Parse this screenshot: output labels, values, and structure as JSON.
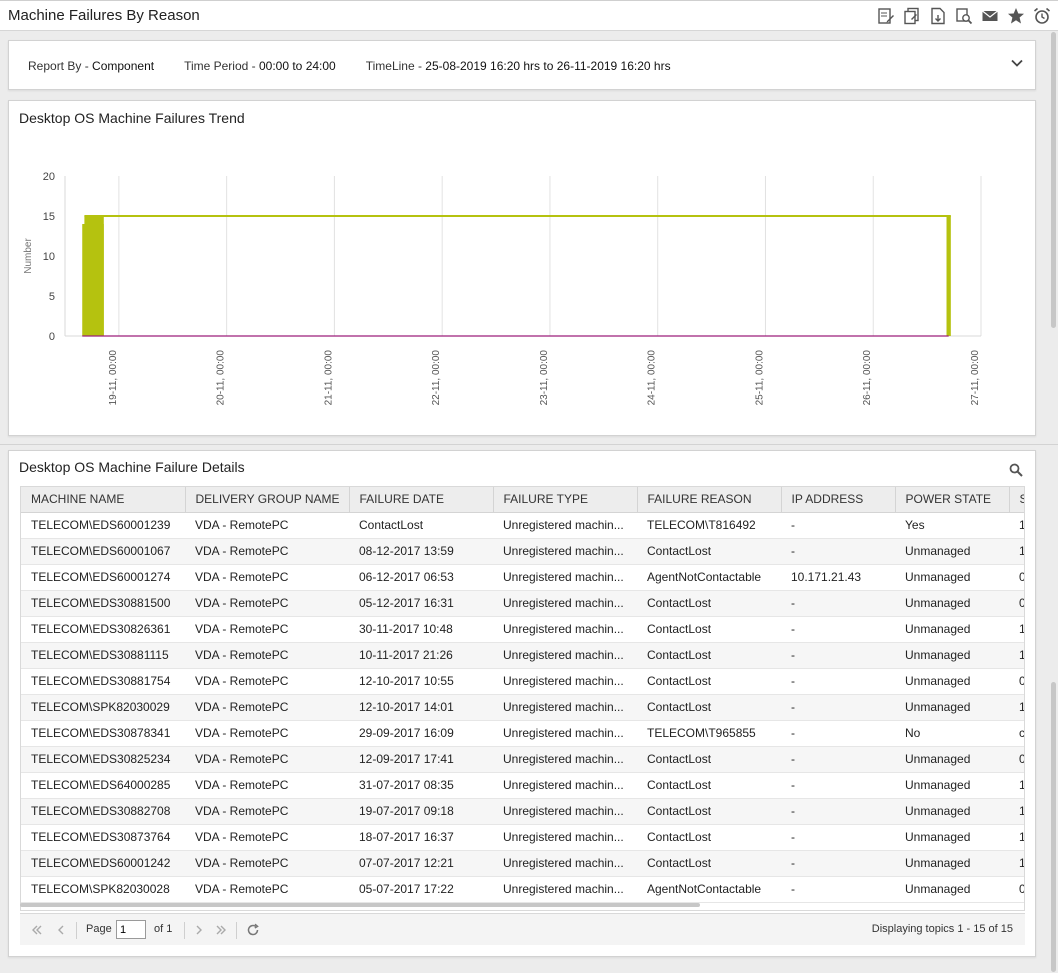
{
  "app": {
    "title": "Machine Failures By Reason"
  },
  "toolbar": {
    "icons": [
      "edit-report-icon",
      "copy-report-icon",
      "export-pdf-icon",
      "print-preview-icon",
      "email-icon",
      "favorite-star-icon",
      "alarm-clock-icon"
    ]
  },
  "filter": {
    "report_by_label": "Report By - ",
    "report_by_value": "Component",
    "time_period_label": "Time Period - ",
    "time_period_value": "00:00 to 24:00",
    "timeline_label": "TimeLine - ",
    "timeline_value": "25-08-2019 16:20 hrs to 26-11-2019 16:20 hrs"
  },
  "chart_panel": {
    "title": "Desktop OS Machine Failures Trend"
  },
  "chart_data": {
    "type": "area",
    "title": "Desktop OS Machine Failures Trend",
    "ylabel": "Number",
    "xlabel": "",
    "ylim": [
      0,
      20
    ],
    "yticks": [
      0,
      5,
      10,
      15,
      20
    ],
    "xlim": [
      18.5,
      27.0
    ],
    "xticks": [
      19,
      20,
      21,
      22,
      23,
      24,
      25,
      26,
      27
    ],
    "xtick_labels": [
      "19-11, 00:00",
      "20-11, 00:00",
      "21-11, 00:00",
      "22-11, 00:00",
      "23-11, 00:00",
      "24-11, 00:00",
      "25-11, 00:00",
      "26-11, 00:00",
      "27-11, 00:00"
    ],
    "grid": "vertical",
    "colors": {
      "series_main": "#b5c20f",
      "series_secondary": "#9c1f7b"
    },
    "series": [
      {
        "x": [
          18.66,
          18.68,
          18.7,
          18.72,
          18.86,
          26.68,
          26.72
        ],
        "y": [
          14,
          15,
          15,
          15,
          15,
          15,
          0
        ]
      },
      {
        "x": [
          18.66,
          26.7
        ],
        "y": [
          0,
          0
        ]
      }
    ]
  },
  "table_panel": {
    "title": "Desktop OS Machine Failure Details"
  },
  "table": {
    "columns": [
      "MACHINE NAME",
      "DELIVERY GROUP NAME",
      "FAILURE DATE",
      "FAILURE TYPE",
      "FAILURE REASON",
      "IP ADDRESS",
      "POWER STATE",
      "S"
    ],
    "rows": [
      [
        "TELECOM\\EDS60001239",
        "VDA - RemotePC",
        "ContactLost",
        "Unregistered machin...",
        "TELECOM\\T816492",
        "-",
        "Yes",
        "1"
      ],
      [
        "TELECOM\\EDS60001067",
        "VDA - RemotePC",
        "08-12-2017 13:59",
        "Unregistered machin...",
        "ContactLost",
        "-",
        "Unmanaged",
        "1"
      ],
      [
        "TELECOM\\EDS60001274",
        "VDA - RemotePC",
        "06-12-2017 06:53",
        "Unregistered machin...",
        "AgentNotContactable",
        "10.171.21.43",
        "Unmanaged",
        "0"
      ],
      [
        "TELECOM\\EDS30881500",
        "VDA - RemotePC",
        "05-12-2017 16:31",
        "Unregistered machin...",
        "ContactLost",
        "-",
        "Unmanaged",
        "0"
      ],
      [
        "TELECOM\\EDS30826361",
        "VDA - RemotePC",
        "30-11-2017 10:48",
        "Unregistered machin...",
        "ContactLost",
        "-",
        "Unmanaged",
        "1"
      ],
      [
        "TELECOM\\EDS30881115",
        "VDA - RemotePC",
        "10-11-2017 21:26",
        "Unregistered machin...",
        "ContactLost",
        "-",
        "Unmanaged",
        "1"
      ],
      [
        "TELECOM\\EDS30881754",
        "VDA - RemotePC",
        "12-10-2017 10:55",
        "Unregistered machin...",
        "ContactLost",
        "-",
        "Unmanaged",
        "0"
      ],
      [
        "TELECOM\\SPK82030029",
        "VDA - RemotePC",
        "12-10-2017 14:01",
        "Unregistered machin...",
        "ContactLost",
        "-",
        "Unmanaged",
        "1"
      ],
      [
        "TELECOM\\EDS30878341",
        "VDA - RemotePC",
        "29-09-2017 16:09",
        "Unregistered machin...",
        "TELECOM\\T965855",
        "-",
        "No",
        "c"
      ],
      [
        "TELECOM\\EDS30825234",
        "VDA - RemotePC",
        "12-09-2017 17:41",
        "Unregistered machin...",
        "ContactLost",
        "-",
        "Unmanaged",
        "0"
      ],
      [
        "TELECOM\\EDS64000285",
        "VDA - RemotePC",
        "31-07-2017 08:35",
        "Unregistered machin...",
        "ContactLost",
        "-",
        "Unmanaged",
        "1"
      ],
      [
        "TELECOM\\EDS30882708",
        "VDA - RemotePC",
        "19-07-2017 09:18",
        "Unregistered machin...",
        "ContactLost",
        "-",
        "Unmanaged",
        "1"
      ],
      [
        "TELECOM\\EDS30873764",
        "VDA - RemotePC",
        "18-07-2017 16:37",
        "Unregistered machin...",
        "ContactLost",
        "-",
        "Unmanaged",
        "1"
      ],
      [
        "TELECOM\\EDS60001242",
        "VDA - RemotePC",
        "07-07-2017 12:21",
        "Unregistered machin...",
        "ContactLost",
        "-",
        "Unmanaged",
        "1"
      ],
      [
        "TELECOM\\SPK82030028",
        "VDA - RemotePC",
        "05-07-2017 17:22",
        "Unregistered machin...",
        "AgentNotContactable",
        "-",
        "Unmanaged",
        "0"
      ]
    ]
  },
  "pager": {
    "page_label": "Page",
    "page_value": "1",
    "of_label": "of 1",
    "display_text": "Displaying topics 1 - 15 of 15"
  }
}
